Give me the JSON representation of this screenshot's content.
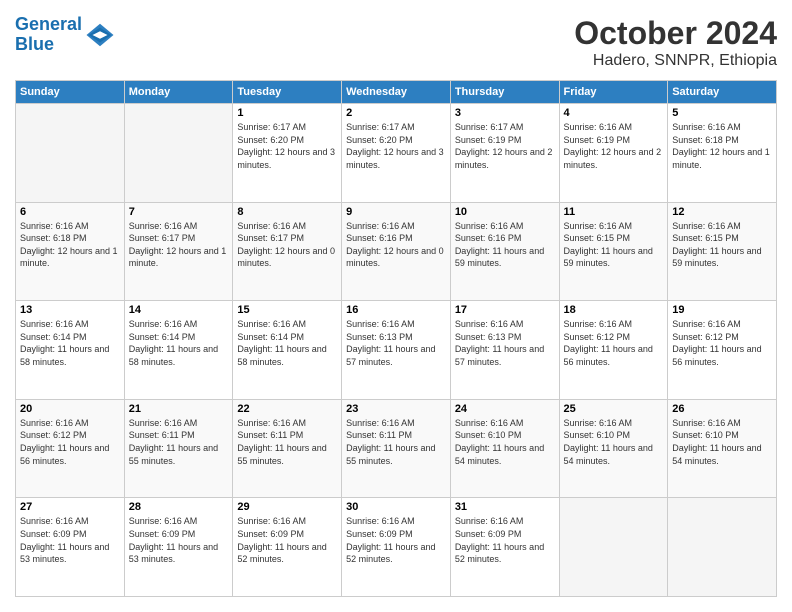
{
  "logo": {
    "line1": "General",
    "line2": "Blue"
  },
  "title": "October 2024",
  "subtitle": "Hadero, SNNPR, Ethiopia",
  "days_of_week": [
    "Sunday",
    "Monday",
    "Tuesday",
    "Wednesday",
    "Thursday",
    "Friday",
    "Saturday"
  ],
  "weeks": [
    [
      {
        "day": "",
        "info": ""
      },
      {
        "day": "",
        "info": ""
      },
      {
        "day": "1",
        "info": "Sunrise: 6:17 AM\nSunset: 6:20 PM\nDaylight: 12 hours and 3 minutes."
      },
      {
        "day": "2",
        "info": "Sunrise: 6:17 AM\nSunset: 6:20 PM\nDaylight: 12 hours and 3 minutes."
      },
      {
        "day": "3",
        "info": "Sunrise: 6:17 AM\nSunset: 6:19 PM\nDaylight: 12 hours and 2 minutes."
      },
      {
        "day": "4",
        "info": "Sunrise: 6:16 AM\nSunset: 6:19 PM\nDaylight: 12 hours and 2 minutes."
      },
      {
        "day": "5",
        "info": "Sunrise: 6:16 AM\nSunset: 6:18 PM\nDaylight: 12 hours and 1 minute."
      }
    ],
    [
      {
        "day": "6",
        "info": "Sunrise: 6:16 AM\nSunset: 6:18 PM\nDaylight: 12 hours and 1 minute."
      },
      {
        "day": "7",
        "info": "Sunrise: 6:16 AM\nSunset: 6:17 PM\nDaylight: 12 hours and 1 minute."
      },
      {
        "day": "8",
        "info": "Sunrise: 6:16 AM\nSunset: 6:17 PM\nDaylight: 12 hours and 0 minutes."
      },
      {
        "day": "9",
        "info": "Sunrise: 6:16 AM\nSunset: 6:16 PM\nDaylight: 12 hours and 0 minutes."
      },
      {
        "day": "10",
        "info": "Sunrise: 6:16 AM\nSunset: 6:16 PM\nDaylight: 11 hours and 59 minutes."
      },
      {
        "day": "11",
        "info": "Sunrise: 6:16 AM\nSunset: 6:15 PM\nDaylight: 11 hours and 59 minutes."
      },
      {
        "day": "12",
        "info": "Sunrise: 6:16 AM\nSunset: 6:15 PM\nDaylight: 11 hours and 59 minutes."
      }
    ],
    [
      {
        "day": "13",
        "info": "Sunrise: 6:16 AM\nSunset: 6:14 PM\nDaylight: 11 hours and 58 minutes."
      },
      {
        "day": "14",
        "info": "Sunrise: 6:16 AM\nSunset: 6:14 PM\nDaylight: 11 hours and 58 minutes."
      },
      {
        "day": "15",
        "info": "Sunrise: 6:16 AM\nSunset: 6:14 PM\nDaylight: 11 hours and 58 minutes."
      },
      {
        "day": "16",
        "info": "Sunrise: 6:16 AM\nSunset: 6:13 PM\nDaylight: 11 hours and 57 minutes."
      },
      {
        "day": "17",
        "info": "Sunrise: 6:16 AM\nSunset: 6:13 PM\nDaylight: 11 hours and 57 minutes."
      },
      {
        "day": "18",
        "info": "Sunrise: 6:16 AM\nSunset: 6:12 PM\nDaylight: 11 hours and 56 minutes."
      },
      {
        "day": "19",
        "info": "Sunrise: 6:16 AM\nSunset: 6:12 PM\nDaylight: 11 hours and 56 minutes."
      }
    ],
    [
      {
        "day": "20",
        "info": "Sunrise: 6:16 AM\nSunset: 6:12 PM\nDaylight: 11 hours and 56 minutes."
      },
      {
        "day": "21",
        "info": "Sunrise: 6:16 AM\nSunset: 6:11 PM\nDaylight: 11 hours and 55 minutes."
      },
      {
        "day": "22",
        "info": "Sunrise: 6:16 AM\nSunset: 6:11 PM\nDaylight: 11 hours and 55 minutes."
      },
      {
        "day": "23",
        "info": "Sunrise: 6:16 AM\nSunset: 6:11 PM\nDaylight: 11 hours and 55 minutes."
      },
      {
        "day": "24",
        "info": "Sunrise: 6:16 AM\nSunset: 6:10 PM\nDaylight: 11 hours and 54 minutes."
      },
      {
        "day": "25",
        "info": "Sunrise: 6:16 AM\nSunset: 6:10 PM\nDaylight: 11 hours and 54 minutes."
      },
      {
        "day": "26",
        "info": "Sunrise: 6:16 AM\nSunset: 6:10 PM\nDaylight: 11 hours and 54 minutes."
      }
    ],
    [
      {
        "day": "27",
        "info": "Sunrise: 6:16 AM\nSunset: 6:09 PM\nDaylight: 11 hours and 53 minutes."
      },
      {
        "day": "28",
        "info": "Sunrise: 6:16 AM\nSunset: 6:09 PM\nDaylight: 11 hours and 53 minutes."
      },
      {
        "day": "29",
        "info": "Sunrise: 6:16 AM\nSunset: 6:09 PM\nDaylight: 11 hours and 52 minutes."
      },
      {
        "day": "30",
        "info": "Sunrise: 6:16 AM\nSunset: 6:09 PM\nDaylight: 11 hours and 52 minutes."
      },
      {
        "day": "31",
        "info": "Sunrise: 6:16 AM\nSunset: 6:09 PM\nDaylight: 11 hours and 52 minutes."
      },
      {
        "day": "",
        "info": ""
      },
      {
        "day": "",
        "info": ""
      }
    ]
  ]
}
